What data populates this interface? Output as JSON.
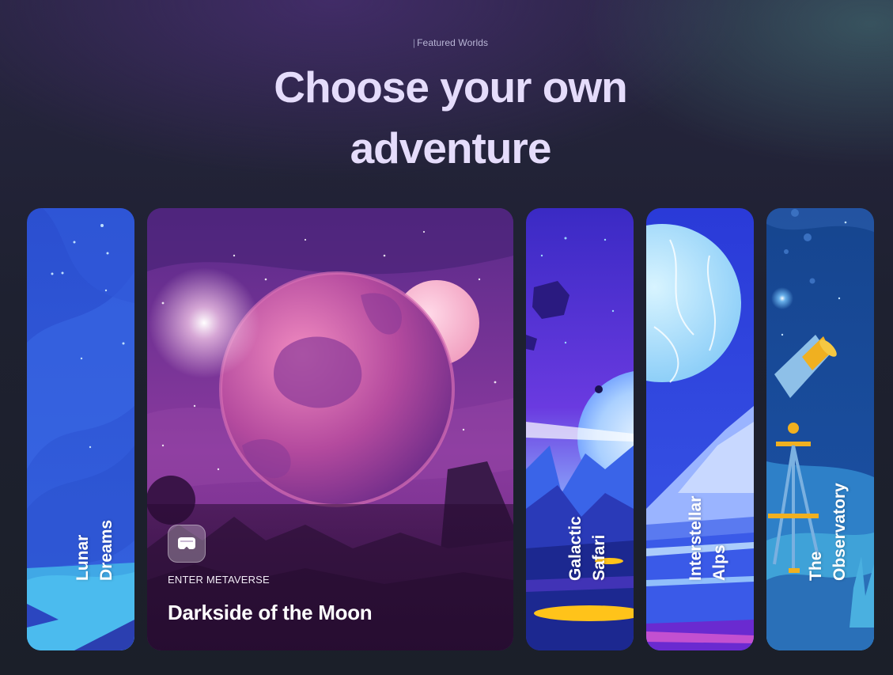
{
  "section": {
    "eyebrow": "Featured Worlds",
    "headline_line1": "Choose your own",
    "headline_line2": "adventure"
  },
  "cards": [
    {
      "name": "lunar-dreams",
      "title_line1": "Lunar",
      "title_line2": "Dreams",
      "expanded": false
    },
    {
      "name": "darkside-of-the-moon",
      "cta": "ENTER METAVERSE",
      "title": "Darkside of the Moon",
      "icon": "vr-headset-icon",
      "expanded": true
    },
    {
      "name": "galactic-safari",
      "title_line1": "Galactic",
      "title_line2": "Safari",
      "expanded": false
    },
    {
      "name": "interstellar-alps",
      "title_line1": "Interstellar",
      "title_line2": "Alps",
      "expanded": false
    },
    {
      "name": "the-observatory",
      "title_line1": "The",
      "title_line2": "Observatory",
      "expanded": false
    }
  ],
  "colors": {
    "headline": "#e5dcfb",
    "background": "#1e2130",
    "lunar": "#2f55d6",
    "darkside": "#7a2d96",
    "galactic": "#4a2fd0",
    "interstellar": "#3d5ae8",
    "observatory": "#1d4fa0"
  }
}
